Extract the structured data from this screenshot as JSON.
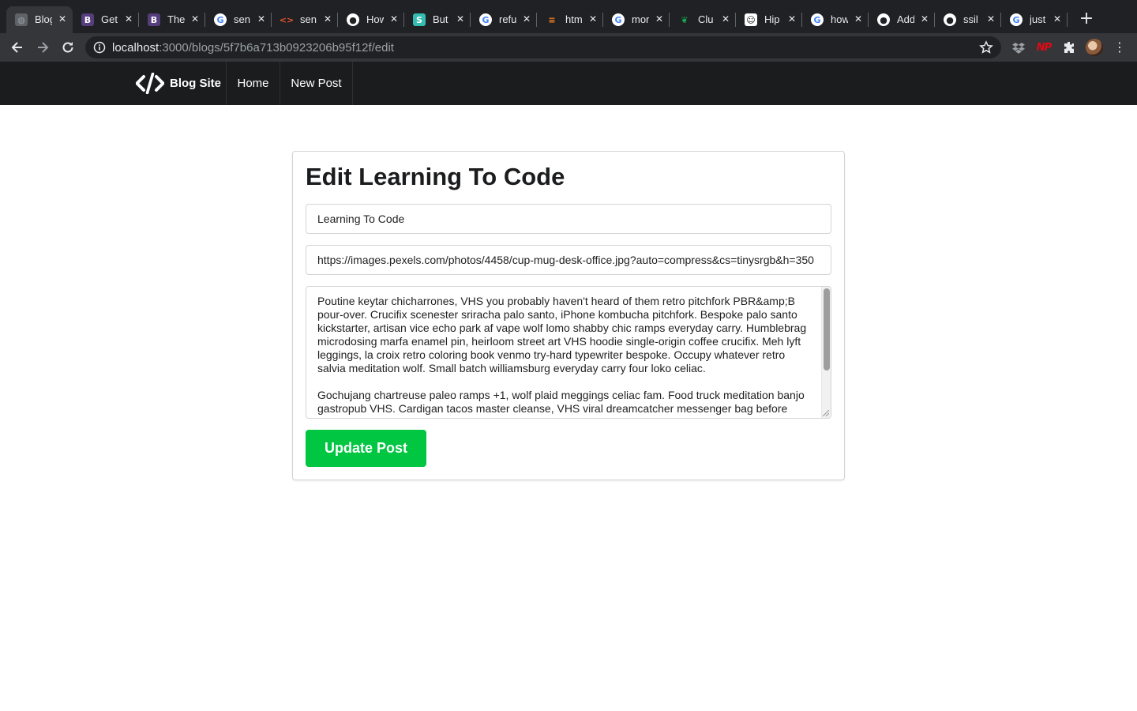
{
  "browser": {
    "tabs": [
      {
        "title": "Blog",
        "favicon": "globe-icon"
      },
      {
        "title": "Get",
        "favicon": "bootstrap-icon"
      },
      {
        "title": "The",
        "favicon": "bootstrap-icon"
      },
      {
        "title": "sen",
        "favicon": "google-icon"
      },
      {
        "title": "sen",
        "favicon": "code-icon"
      },
      {
        "title": "How",
        "favicon": "github-icon"
      },
      {
        "title": "But",
        "favicon": "semantic-ui-icon"
      },
      {
        "title": "refu",
        "favicon": "google-icon"
      },
      {
        "title": "htm",
        "favicon": "stackoverflow-icon"
      },
      {
        "title": "mor",
        "favicon": "google-icon"
      },
      {
        "title": "Clu",
        "favicon": "mongodb-leaf-icon"
      },
      {
        "title": "Hip",
        "favicon": "hipster-ipsum-icon"
      },
      {
        "title": "how",
        "favicon": "google-icon"
      },
      {
        "title": "Add",
        "favicon": "github-icon"
      },
      {
        "title": "ssil",
        "favicon": "github-icon"
      },
      {
        "title": "just",
        "favicon": "google-icon"
      }
    ],
    "active_tab": 0,
    "url_host": "localhost",
    "url_path": ":3000/blogs/5f7b6a713b0923206b95f12f/edit",
    "extensions": [
      "dropbox-icon",
      "np-extension-icon",
      "puzzle-extensions-icon"
    ]
  },
  "site": {
    "brand": "Blog Site",
    "nav": [
      {
        "label": "Home"
      },
      {
        "label": "New Post"
      }
    ]
  },
  "form": {
    "heading": "Edit Learning To Code",
    "title_value": "Learning To Code",
    "image_value": "https://images.pexels.com/photos/4458/cup-mug-desk-office.jpg?auto=compress&cs=tinysrgb&h=350",
    "body_value": "Poutine keytar chicharrones, VHS you probably haven't heard of them retro pitchfork PBR&amp;B pour-over. Crucifix scenester sriracha palo santo, iPhone kombucha pitchfork. Bespoke palo santo kickstarter, artisan vice echo park af vape wolf lomo shabby chic ramps everyday carry. Humblebrag microdosing marfa enamel pin, heirloom street art VHS hoodie single-origin coffee crucifix. Meh lyft leggings, la croix retro coloring book venmo try-hard typewriter bespoke. Occupy whatever retro salvia meditation wolf. Small batch williamsburg everyday carry four loko celiac.\n\nGochujang chartreuse paleo ramps +1, wolf plaid meggings celiac fam. Food truck meditation banjo gastropub VHS. Cardigan tacos master cleanse, VHS viral dreamcatcher messenger bag before they",
    "submit_label": "Update Post"
  },
  "colors": {
    "nav_bg": "#1b1c1d",
    "submit_green": "#00c642",
    "heading": "#1b1c1d"
  }
}
